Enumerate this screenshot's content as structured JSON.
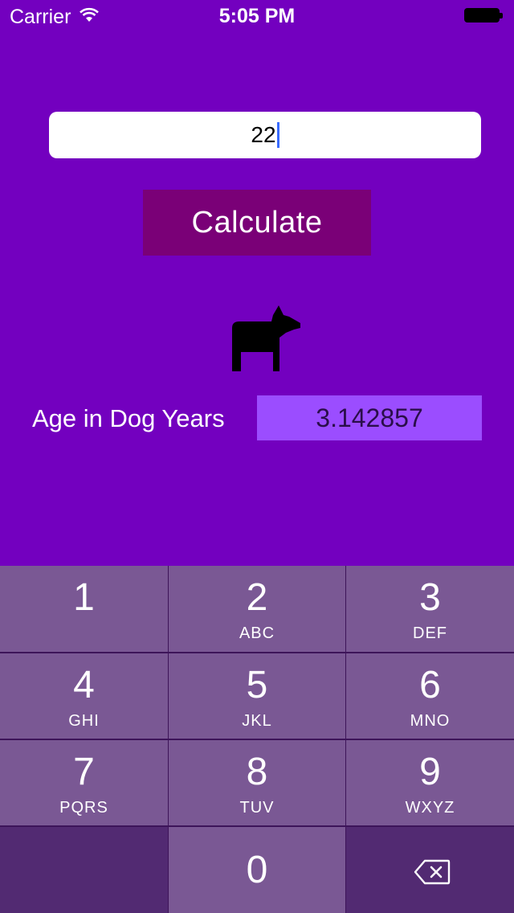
{
  "status_bar": {
    "carrier": "Carrier",
    "time": "5:05 PM",
    "icons": [
      "wifi-icon",
      "battery-icon"
    ]
  },
  "input": {
    "value": "22"
  },
  "calculate_button": {
    "label": "Calculate"
  },
  "dog_icon": "dog-icon",
  "result": {
    "label": "Age in Dog Years",
    "value": "3.142857"
  },
  "keypad": {
    "keys": [
      {
        "digit": "1",
        "letters": ""
      },
      {
        "digit": "2",
        "letters": "ABC"
      },
      {
        "digit": "3",
        "letters": "DEF"
      },
      {
        "digit": "4",
        "letters": "GHI"
      },
      {
        "digit": "5",
        "letters": "JKL"
      },
      {
        "digit": "6",
        "letters": "MNO"
      },
      {
        "digit": "7",
        "letters": "PQRS"
      },
      {
        "digit": "8",
        "letters": "TUV"
      },
      {
        "digit": "9",
        "letters": "WXYZ"
      },
      {
        "digit": "0",
        "letters": ""
      }
    ],
    "delete_icon": "backspace-icon"
  },
  "colors": {
    "background": "#7300bf",
    "button": "#7a0077",
    "result_field": "#9b4dff",
    "key": "#7a5894",
    "key_dark": "#522a72"
  }
}
